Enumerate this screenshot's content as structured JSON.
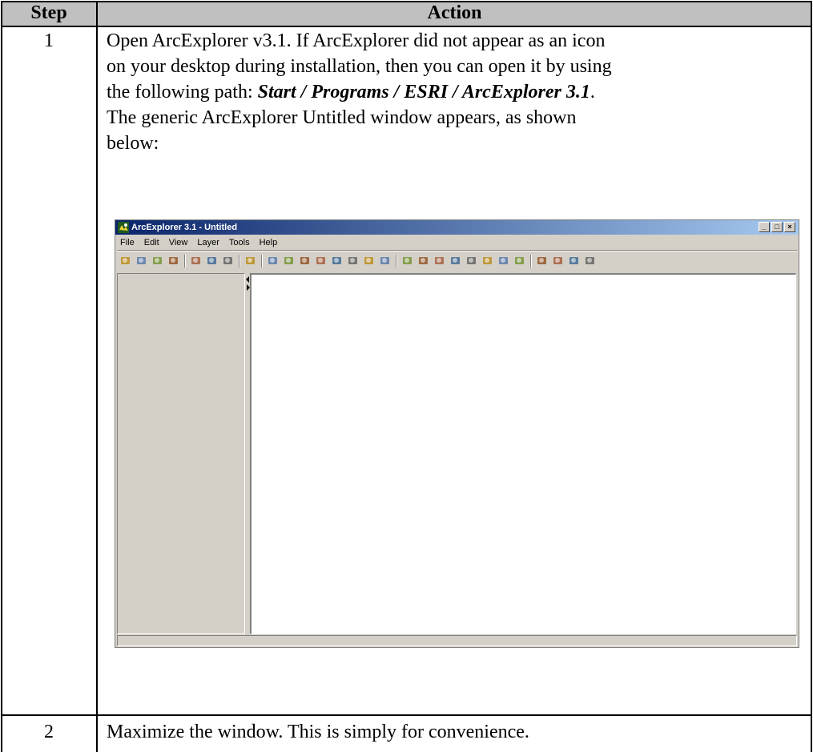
{
  "table": {
    "headers": {
      "step": "Step",
      "action": "Action"
    },
    "rows": [
      {
        "step": "1",
        "lines": [
          "Open ArcExplorer v3.1.  If ArcExplorer did not appear as an icon",
          "on your desktop during installation, then you can open it by using",
          "The generic ArcExplorer Untitled window appears, as shown",
          "below:"
        ],
        "path_prefix": "the following path: ",
        "path_bold": "Start / Programs / ESRI / ArcExplorer 3.1",
        "path_suffix": "."
      },
      {
        "step": "2",
        "text": "Maximize the window.  This is simply for convenience."
      }
    ]
  },
  "app": {
    "title": "ArcExplorer 3.1 - Untitled",
    "window_buttons": [
      "_",
      "□",
      "×"
    ],
    "menu": [
      "File",
      "Edit",
      "View",
      "Layer",
      "Tools",
      "Help"
    ],
    "toolbar_icons": [
      "open-folder-icon",
      "save-icon",
      "add-layer-icon",
      "remove-layer-icon",
      "add-theme-icon",
      "add-image-icon",
      "print-icon",
      "globe-icon",
      "zoom-in-icon",
      "zoom-out-icon",
      "full-extent-icon",
      "active-extent-icon",
      "zoom-previous-icon",
      "zoom-next-icon",
      "pan-icon",
      "pan-direction-icon",
      "identify-icon",
      "query-icon",
      "find-icon",
      "hyperlink-icon",
      "measure-icon",
      "buffer-icon",
      "select-icon",
      "clear-select-icon",
      "edit-icon",
      "spatial-query-icon",
      "layer-properties-icon",
      "overview-icon"
    ]
  },
  "colors": {
    "header_bg": "#c0c0c0",
    "title_gradient_start": "#0a246a",
    "title_gradient_end": "#a6caf0",
    "window_face": "#d4d0c8"
  }
}
